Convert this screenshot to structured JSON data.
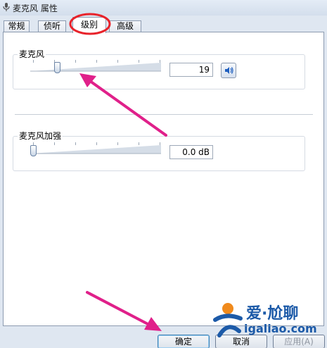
{
  "window": {
    "title": "麦克风 属性"
  },
  "tabs": [
    {
      "label": "常规"
    },
    {
      "label": "侦听"
    },
    {
      "label": "级别"
    },
    {
      "label": "高级"
    }
  ],
  "levels": {
    "microphone": {
      "label": "麦克风",
      "value": "19",
      "slider_fraction": 0.19
    },
    "boost": {
      "label": "麦克风加强",
      "value": "0.0 dB",
      "slider_fraction": 0.0
    }
  },
  "buttons": {
    "ok": "确定",
    "cancel": "取消",
    "apply": "应用(A)"
  },
  "watermark": {
    "brand": "爱·尬聊",
    "domain": "igaliao.com"
  },
  "colors": {
    "annotation": "#e0208a",
    "circle": "#e8232b",
    "brand": "#1c5aa8"
  }
}
